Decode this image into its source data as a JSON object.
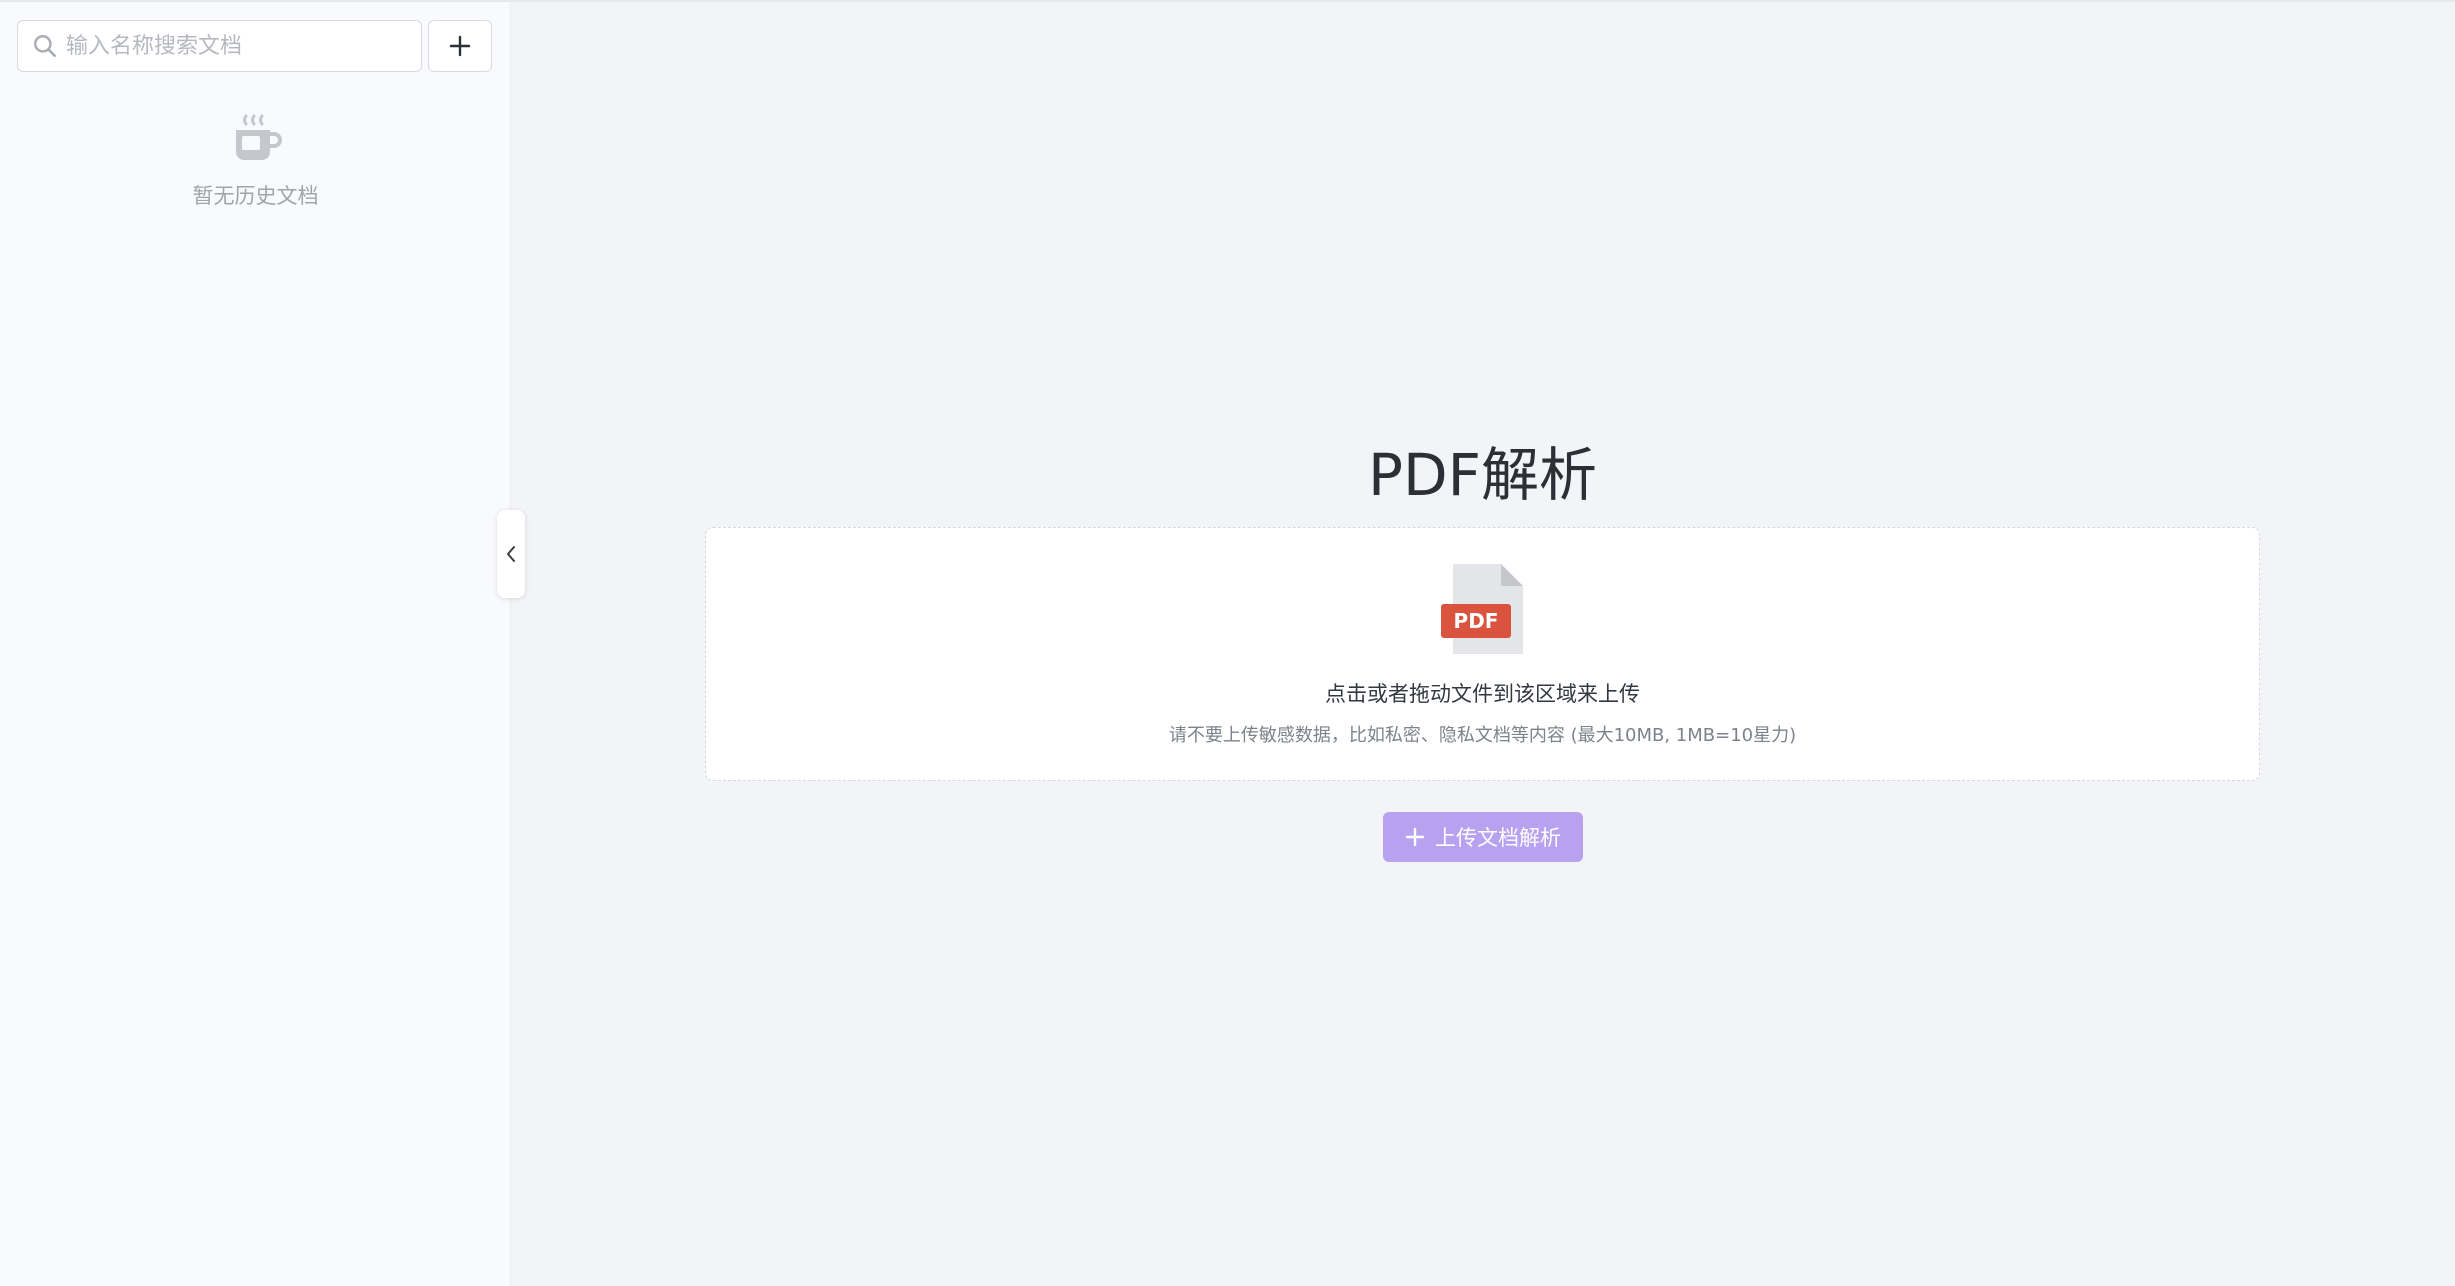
{
  "sidebar": {
    "search": {
      "placeholder": "输入名称搜索文档",
      "value": ""
    },
    "add_icon": "plus-icon",
    "empty_icon": "coffee-cup-icon",
    "empty_text": "暂无历史文档",
    "collapse_icon": "chevron-left-icon"
  },
  "main": {
    "title": "PDF解析",
    "upload_zone": {
      "file_icon_label": "PDF",
      "hint": "点击或者拖动文件到该区域来上传",
      "note": "请不要上传敏感数据，比如私密、隐私文档等内容 (最大10MB, 1MB=10星力)"
    },
    "upload_button": {
      "label": "上传文档解析",
      "icon": "plus-icon"
    }
  },
  "colors": {
    "accent": "#b8a2f0",
    "pdf_badge": "#d9533f",
    "page_bg": "#f2f4f8",
    "sidebar_bg": "#f9fafd"
  }
}
